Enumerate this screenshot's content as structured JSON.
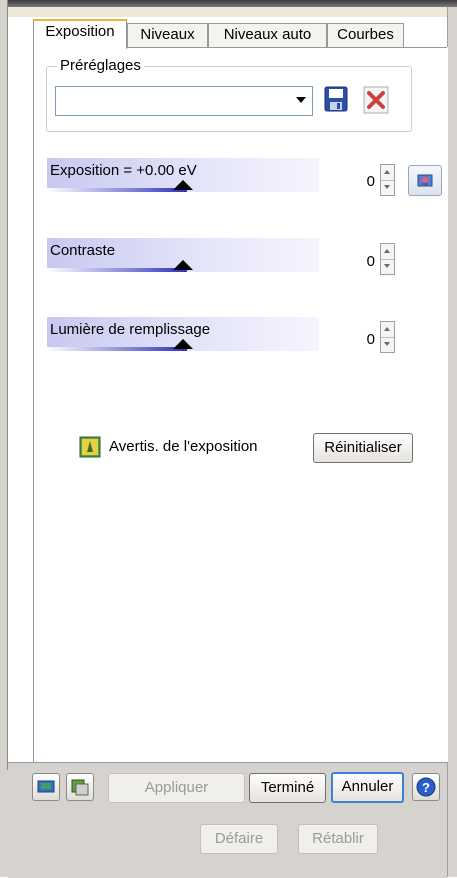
{
  "tabs": [
    {
      "label": "Exposition",
      "active": true
    },
    {
      "label": "Niveaux",
      "active": false
    },
    {
      "label": "Niveaux auto",
      "active": false
    },
    {
      "label": "Courbes",
      "active": false
    }
  ],
  "presets": {
    "legend": "Préréglages",
    "selected": "",
    "save_icon": "floppy-disk-icon",
    "delete_icon": "red-x-icon"
  },
  "sliders": [
    {
      "label": "Exposition = +0.00 eV",
      "value": "0"
    },
    {
      "label": "Contraste",
      "value": "0"
    },
    {
      "label": "Lumière de remplissage",
      "value": "0"
    }
  ],
  "exposure_warning": {
    "label": "Avertis. de l'exposition"
  },
  "reset_button": "Réinitialiser",
  "bottom": {
    "apply": "Appliquer",
    "done": "Terminé",
    "cancel": "Annuler",
    "undo": "Défaire",
    "redo": "Rétablir"
  },
  "colors": {
    "accent": "#3c7fd8",
    "slider": "#3030c0",
    "delete": "#d04040"
  }
}
